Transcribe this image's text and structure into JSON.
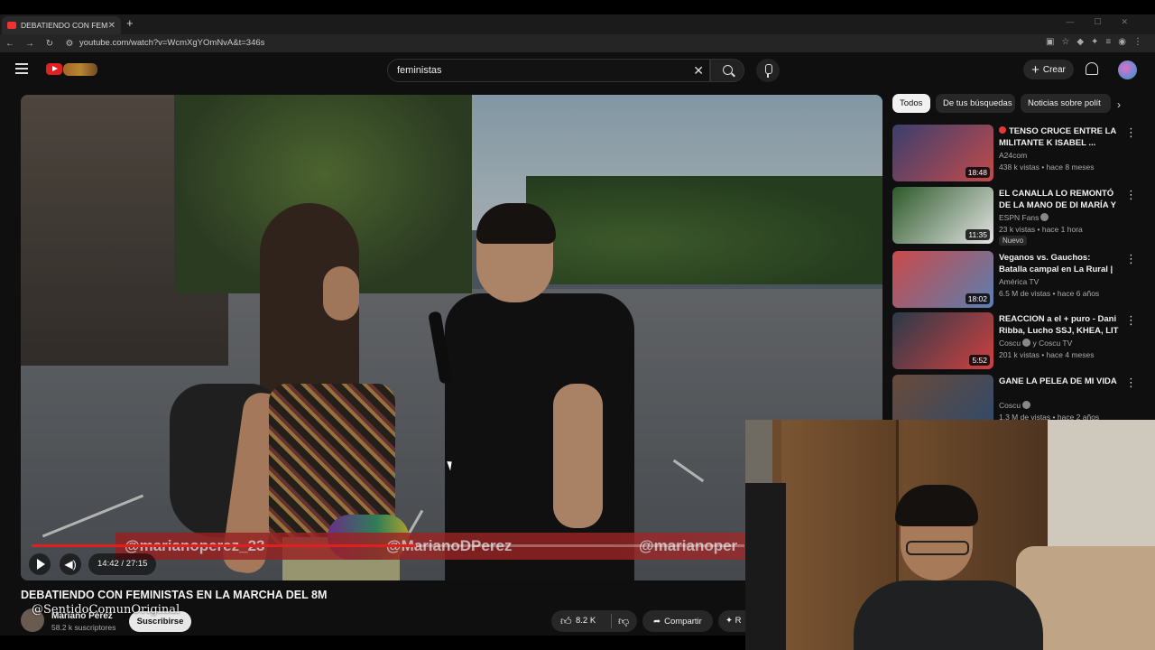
{
  "browser": {
    "tab_title": "DEBATIENDO CON FEMIN",
    "url": "youtube.com/watch?v=WcmXgYOmNvA&t=346s"
  },
  "header": {
    "search_value": "feministas",
    "create_label": "Crear"
  },
  "video": {
    "banner_handles": [
      "@marianoperez_23",
      "@MarianoDPerez",
      "@marianoper"
    ],
    "time": "14:42 / 27:15",
    "progress_fraction": 0.539,
    "title": "DEBATIENDO CON FEMINISTAS EN LA MARCHA DEL 8M",
    "channel_name": "Mariano Pérez",
    "subscribers": "58.2 k suscriptores",
    "subscribe_label": "Suscribirse",
    "likes": "8.2 K",
    "share_label": "Compartir",
    "more_label": "R",
    "watermark": "@SentidoComunOriginal"
  },
  "chips": [
    "Todos",
    "De tus búsquedas",
    "Noticias sobre polít"
  ],
  "recommendations": [
    {
      "title": "TENSO CRUCE ENTRE LA MILITANTE K ISABEL ...",
      "channel": "A24com",
      "meta": "438 k vistas • hace 8 meses",
      "duration": "18:48",
      "badge": "",
      "thumb_colors": [
        "#3a3f6e",
        "#c24a4a"
      ]
    },
    {
      "title": "EL CANALLA LO REMONTÓ DE LA MANO DE DI MARÍA Y ES ...",
      "channel": "ESPN Fans",
      "meta": "23 k vistas • hace 1 hora",
      "duration": "11:35",
      "badge": "Nuevo",
      "thumb_colors": [
        "#2d5a2a",
        "#e4e4e4"
      ]
    },
    {
      "title": "Veganos vs. Gauchos: Batalla campal en La Rural | Debate ...",
      "channel": "América TV",
      "meta": "6.5 M de vistas • hace 6 años",
      "duration": "18:02",
      "badge": "",
      "thumb_colors": [
        "#c94a4a",
        "#5a7fb0"
      ]
    },
    {
      "title": "REACCION a el + puro - Dani Ribba, Lucho SSJ, KHEA, LIT ...",
      "channel": "Coscu",
      "channel_extra": "y Coscu TV",
      "meta": "201 k vistas • hace 4 meses",
      "duration": "5:52",
      "badge": "",
      "thumb_colors": [
        "#2a3a4a",
        "#d04040"
      ]
    },
    {
      "title": "GANE LA PELEA DE MI VIDA",
      "channel": "Coscu",
      "meta": "1.3 M de vistas • hace 2 años",
      "duration": "",
      "badge": "",
      "thumb_colors": [
        "#6a4a3a",
        "#2f4a6a"
      ]
    }
  ]
}
